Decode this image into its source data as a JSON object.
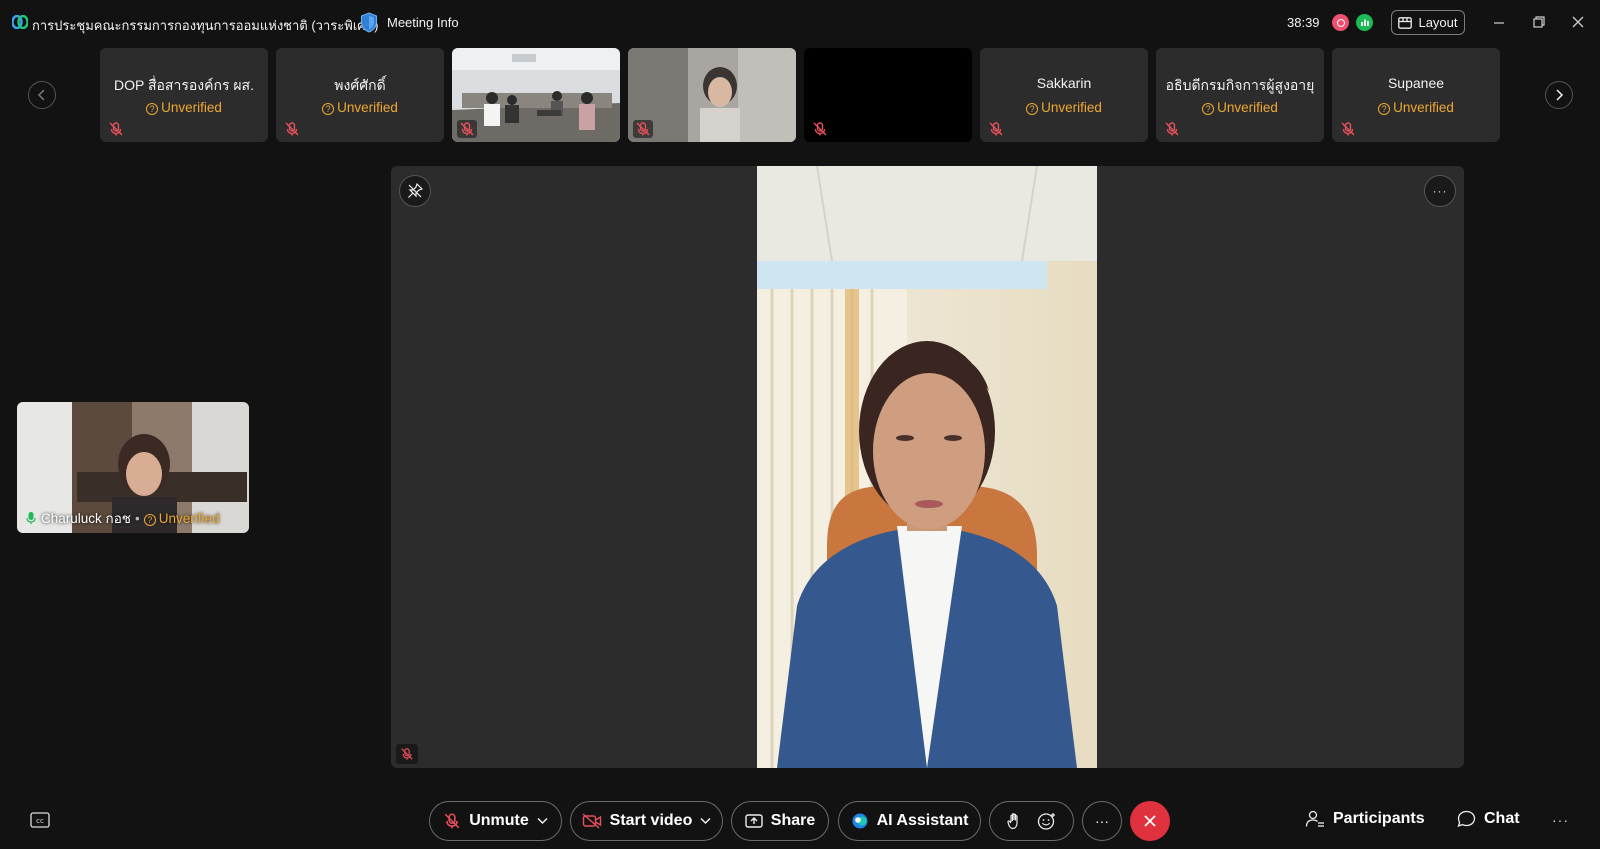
{
  "titlebar": {
    "meeting_title": "การประชุมคณะกรรมการกองทุนการออมแห่งชาติ (วาระพิเศษ)",
    "meeting_info": "Meeting Info",
    "timer": "38:39",
    "layout_label": "Layout"
  },
  "filmstrip": {
    "tiles": [
      {
        "name": "DOP สื่อสารองค์กร ผส.",
        "status": "Unverified"
      },
      {
        "name": "พงศ์ศักดิ์",
        "status": "Unverified"
      },
      {
        "name": "",
        "status": ""
      },
      {
        "name": "",
        "status": ""
      },
      {
        "name": "",
        "status": ""
      },
      {
        "name": "Sakkarin",
        "status": "Unverified"
      },
      {
        "name": "อธิบดีกรมกิจการผู้สูงอายุ",
        "status": "Unverified"
      },
      {
        "name": "Supanee",
        "status": "Unverified"
      }
    ]
  },
  "self_view": {
    "name": "Charuluck กอช",
    "separator": "•",
    "status": "Unverified"
  },
  "toolbar": {
    "unmute": "Unmute",
    "start_video": "Start video",
    "share": "Share",
    "ai_assistant": "AI Assistant",
    "more": "···",
    "participants": "Participants",
    "chat": "Chat",
    "overflow": "···"
  },
  "stage": {
    "more": "···"
  },
  "colors": {
    "background": "#121212",
    "tile": "#2c2c2c",
    "unverified": "#f0a832",
    "leave": "#e0313f",
    "mute_red": "#e8505b"
  }
}
